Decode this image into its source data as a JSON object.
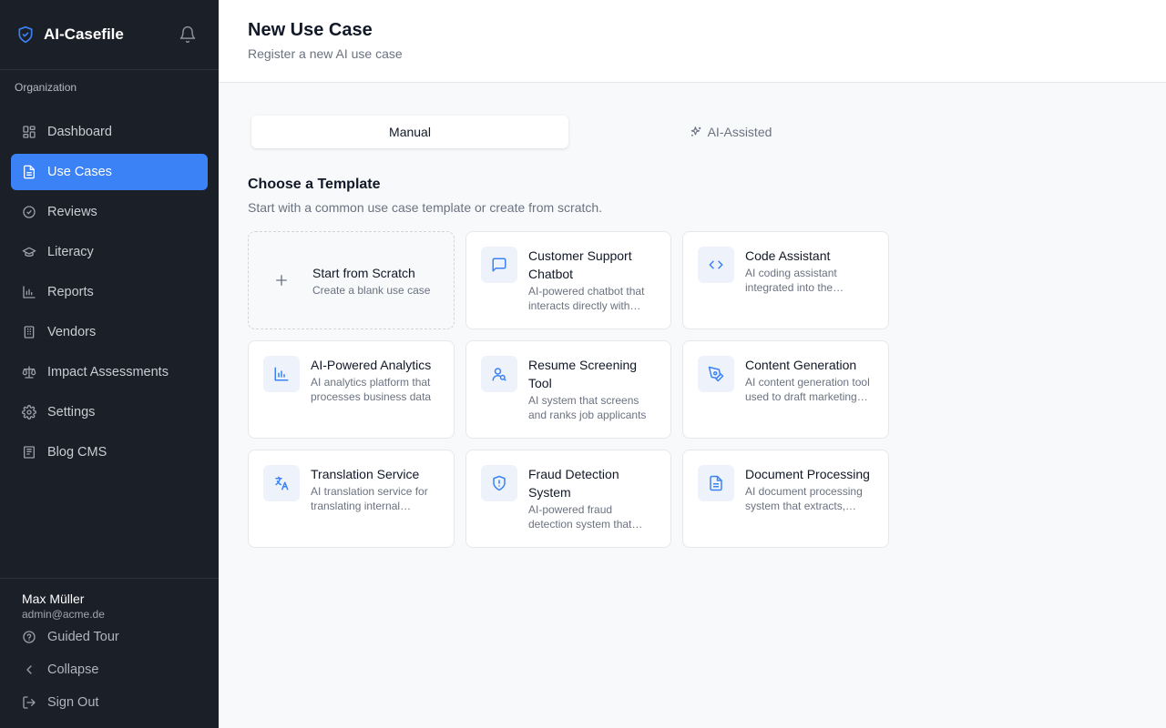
{
  "app": {
    "name": "AI-Casefile"
  },
  "sidebar": {
    "org_label": "Organization",
    "items": [
      {
        "label": "Dashboard",
        "icon": "dashboard-icon",
        "active": false
      },
      {
        "label": "Use Cases",
        "icon": "document-icon",
        "active": true
      },
      {
        "label": "Reviews",
        "icon": "check-circle-icon",
        "active": false
      },
      {
        "label": "Literacy",
        "icon": "graduation-cap-icon",
        "active": false
      },
      {
        "label": "Reports",
        "icon": "bar-chart-icon",
        "active": false
      },
      {
        "label": "Vendors",
        "icon": "building-icon",
        "active": false
      },
      {
        "label": "Impact Assessments",
        "icon": "scale-icon",
        "active": false
      },
      {
        "label": "Settings",
        "icon": "gear-icon",
        "active": false
      },
      {
        "label": "Blog CMS",
        "icon": "newspaper-icon",
        "active": false
      }
    ],
    "user": {
      "name": "Max Müller",
      "email": "admin@acme.de"
    },
    "footer": [
      {
        "label": "Guided Tour",
        "icon": "help-circle-icon"
      },
      {
        "label": "Collapse",
        "icon": "chevron-left-icon"
      },
      {
        "label": "Sign Out",
        "icon": "sign-out-icon"
      }
    ]
  },
  "header": {
    "title": "New Use Case",
    "subtitle": "Register a new AI use case"
  },
  "tabs": [
    {
      "label": "Manual",
      "active": true,
      "icon": ""
    },
    {
      "label": "AI-Assisted",
      "active": false,
      "icon": "sparkles-icon"
    }
  ],
  "templates": {
    "title": "Choose a Template",
    "description": "Start with a common use case template or create from scratch.",
    "scratch": {
      "title": "Start from Scratch",
      "description": "Create a blank use case",
      "icon": "plus-icon"
    },
    "items": [
      {
        "title": "Customer Support Chatbot",
        "description": "AI-powered chatbot that interacts directly with customers",
        "icon": "message-icon"
      },
      {
        "title": "Code Assistant",
        "description": "AI coding assistant integrated into the development workflow",
        "icon": "code-icon"
      },
      {
        "title": "AI-Powered Analytics",
        "description": "AI analytics platform that processes business data",
        "icon": "bar-chart-icon"
      },
      {
        "title": "Resume Screening Tool",
        "description": "AI system that screens and ranks job applicants",
        "icon": "user-search-icon"
      },
      {
        "title": "Content Generation",
        "description": "AI content generation tool used to draft marketing copy",
        "icon": "pen-tool-icon"
      },
      {
        "title": "Translation Service",
        "description": "AI translation service for translating internal documents",
        "icon": "languages-icon"
      },
      {
        "title": "Fraud Detection System",
        "description": "AI-powered fraud detection system that monitors transactions",
        "icon": "shield-alert-icon"
      },
      {
        "title": "Document Processing",
        "description": "AI document processing system that extracts, classifies data",
        "icon": "file-text-icon"
      }
    ]
  },
  "colors": {
    "accent": "#3b82f6",
    "sidebar_bg": "#1b1f27",
    "page_bg": "#f8f9fb"
  }
}
